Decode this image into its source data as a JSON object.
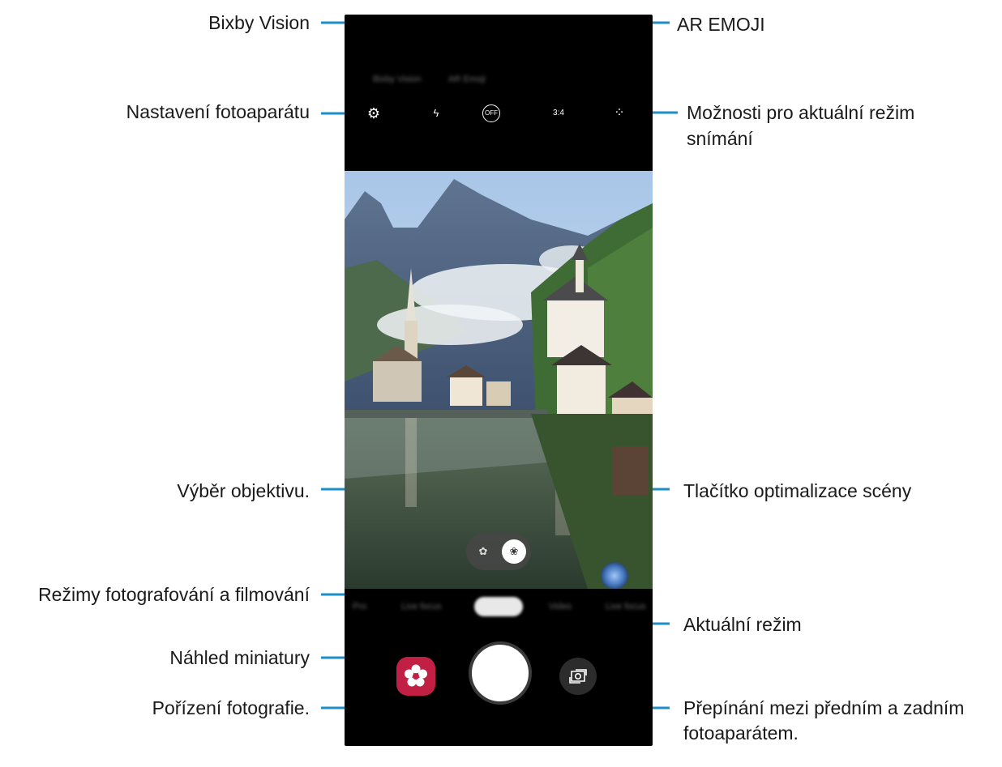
{
  "callouts": {
    "bixby_vision": "Bixby Vision",
    "ar_emoji": "AR EMOJI",
    "camera_settings": "Nastavení fotoaparátu",
    "options_line1": "Možnosti pro aktuální režim",
    "options_line2": "snímání",
    "lens_selection": "Výběr objektivu.",
    "scene_optimizer": "Tlačítko optimalizace scény",
    "shooting_modes": "Režimy fotografování a filmování",
    "current_mode": "Aktuální režim",
    "thumbnail_preview": "Náhled miniatury",
    "take_picture": "Pořízení fotografie.",
    "switch_line1": "Přepínání mezi předním a zadním",
    "switch_line2": "fotoaparátem."
  },
  "phone": {
    "options": [
      {
        "icon": "flash-off-icon",
        "glyph": "ϟ"
      },
      {
        "icon": "timer-off-icon",
        "glyph": "OFF"
      },
      {
        "icon": "aspect-ratio-icon",
        "glyph": "3:4"
      },
      {
        "icon": "filter-effects-icon",
        "glyph": "⁘"
      }
    ],
    "settings_glyph": "⚙",
    "lens_wide_glyph": "✿",
    "lens_normal_glyph": "❀",
    "switch_glyph": "⟲"
  },
  "colors": {
    "callout_line": "#1d8ec6",
    "highlight_box": "#1d8ec6",
    "gallery": "#c21f45"
  }
}
